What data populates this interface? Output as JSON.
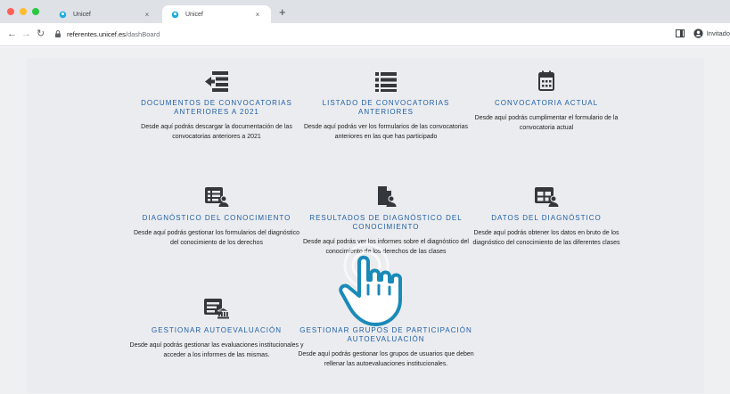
{
  "browser": {
    "tabs": [
      {
        "title": "Unicef",
        "active": false
      },
      {
        "title": "Unicef",
        "active": true
      }
    ],
    "close_glyph": "×",
    "new_tab_glyph": "+",
    "url_domain": "referentes.unicef.es",
    "url_path": "/dashBoard",
    "nav": {
      "back": "←",
      "forward": "→",
      "reload": "↻"
    },
    "profile_label": "Invitado",
    "traffic_colors": [
      "#ff5f57",
      "#febc2e",
      "#28c840"
    ]
  },
  "colors": {
    "title_blue": "#1f5fa6",
    "icon_dark": "#34383d",
    "page_bg": "#eff0f2"
  },
  "cards": [
    {
      "icon": "file-import-icon",
      "title": "DOCUMENTOS DE CONVOCATORIAS ANTERIORES A 2021",
      "desc": "Desde aquí podrás descargar la documentación de las convocatorias anteriores a 2021"
    },
    {
      "icon": "list-icon",
      "title": "LISTADO DE CONVOCATORIAS ANTERIORES",
      "desc": "Desde aquí podrás ver los formularios de las convocatorias anteriores en las que has participado"
    },
    {
      "icon": "calendar-icon",
      "title": "CONVOCATORIA ACTUAL",
      "desc": "Desde aquí podrás cumplimentar el formulario de la convocatoria actual"
    },
    {
      "icon": "list-user-icon",
      "title": "DIAGNÓSTICO DEL CONOCIMIENTO",
      "desc": "Desde aquí podrás gestionar los formularios del diagnóstico del conocimiento de los derechos"
    },
    {
      "icon": "file-user-icon",
      "title": "RESULTADOS DE DIAGNÓSTICO DEL CONOCIMIENTO",
      "desc": "Desde aquí podrás ver los informes sobre el diagnóstico del conocimiento de los derechos de las clases"
    },
    {
      "icon": "table-user-icon",
      "title": "DATOS DEL DIAGNÓSTICO",
      "desc": "Desde aquí podrás obtener los datos en bruto de los diagnóstico del conocimiento de las diferentes clases"
    },
    {
      "icon": "form-institution-icon",
      "title": "GESTIONAR AUTOEVALUACIÓN",
      "desc": "Desde aquí podrás gestionar las evaluaciones institucionales y acceder a los informes de las mismas."
    },
    {
      "icon": "list-table-icon",
      "title": "GESTIONAR GRUPOS DE PARTICIPACIÓN AUTOEVALUACIÓN",
      "desc": "Desde aquí podrás gestionar los grupos de usuarios que deben rellenar las autoevaluaciones institucionales."
    }
  ]
}
